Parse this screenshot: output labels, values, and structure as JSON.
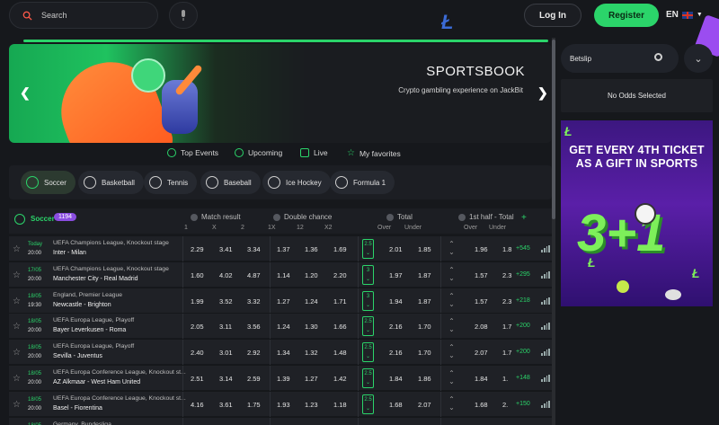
{
  "header": {
    "search_placeholder": "Search",
    "login": "Log In",
    "register": "Register",
    "language": "EN"
  },
  "banner": {
    "title": "SPORTSBOOK",
    "subtitle": "Crypto gambling experience on JackBit"
  },
  "event_tabs": [
    "Top Events",
    "Upcoming",
    "Live",
    "My favorites"
  ],
  "sports": [
    "Soccer",
    "Basketball",
    "Tennis",
    "Baseball",
    "Ice Hockey",
    "Formula 1"
  ],
  "table": {
    "sport": "Soccer",
    "count": "1194",
    "groups": [
      "Match result",
      "Double chance",
      "Total",
      "1st half - Total"
    ],
    "match_result_cols": [
      "1",
      "X",
      "2"
    ],
    "double_chance_cols": [
      "1X",
      "12",
      "X2"
    ],
    "total_cols": [
      "Over",
      "Under"
    ],
    "half_total_cols": [
      "Over",
      "Under"
    ],
    "plus": "+"
  },
  "rows": [
    {
      "d1": "Today",
      "d2": "20:00",
      "league": "UEFA Champions League, Knockout stage",
      "teams": "Inter  -  Milan",
      "o": [
        "2.29",
        "3.41",
        "3.34",
        "1.37",
        "1.36",
        "1.69"
      ],
      "line": "2.5",
      "tot": [
        "2.01",
        "1.85"
      ],
      "half": [
        "1.96",
        "1.8"
      ],
      "more": "+545"
    },
    {
      "d1": "17/05",
      "d2": "20:00",
      "league": "UEFA Champions League, Knockout stage",
      "teams": "Manchester City  -  Real Madrid",
      "o": [
        "1.60",
        "4.02",
        "4.87",
        "1.14",
        "1.20",
        "2.20"
      ],
      "line": "3",
      "tot": [
        "1.97",
        "1.87"
      ],
      "half": [
        "1.57",
        "2.3"
      ],
      "more": "+295"
    },
    {
      "d1": "18/05",
      "d2": "19:30",
      "league": "England, Premier League",
      "teams": "Newcastle  -  Brighton",
      "o": [
        "1.99",
        "3.52",
        "3.32",
        "1.27",
        "1.24",
        "1.71"
      ],
      "line": "3",
      "tot": [
        "1.94",
        "1.87"
      ],
      "half": [
        "1.57",
        "2.3"
      ],
      "more": "+218"
    },
    {
      "d1": "18/05",
      "d2": "20:00",
      "league": "UEFA Europa League, Playoff",
      "teams": "Bayer Leverkusen  -  Roma",
      "o": [
        "2.05",
        "3.11",
        "3.56",
        "1.24",
        "1.30",
        "1.66"
      ],
      "line": "2.5",
      "tot": [
        "2.16",
        "1.70"
      ],
      "half": [
        "2.08",
        "1.7"
      ],
      "more": "+200"
    },
    {
      "d1": "18/05",
      "d2": "20:00",
      "league": "UEFA Europa League, Playoff",
      "teams": "Sevilla  -  Juventus",
      "o": [
        "2.40",
        "3.01",
        "2.92",
        "1.34",
        "1.32",
        "1.48"
      ],
      "line": "2.5",
      "tot": [
        "2.16",
        "1.70"
      ],
      "half": [
        "2.07",
        "1.7"
      ],
      "more": "+200"
    },
    {
      "d1": "18/05",
      "d2": "20:00",
      "league": "UEFA Europa Conference League, Knockout st...",
      "teams": "AZ Alkmaar  -  West Ham United",
      "o": [
        "2.51",
        "3.14",
        "2.59",
        "1.39",
        "1.27",
        "1.42"
      ],
      "line": "2.5",
      "tot": [
        "1.84",
        "1.86"
      ],
      "half": [
        "1.84",
        "1."
      ],
      "more": "+148"
    },
    {
      "d1": "18/05",
      "d2": "20:00",
      "league": "UEFA Europa Conference League, Knockout st...",
      "teams": "Basel  -  Fiorentina",
      "o": [
        "4.16",
        "3.61",
        "1.75",
        "1.93",
        "1.23",
        "1.18"
      ],
      "line": "2.5",
      "tot": [
        "1.68",
        "2.07"
      ],
      "half": [
        "1.68",
        "2."
      ],
      "more": "+150"
    },
    {
      "d1": "18/05",
      "d2": "",
      "league": "Germany, Bundesliga",
      "teams": "",
      "o": [
        "",
        "",
        "",
        "",
        "",
        ""
      ],
      "line": "",
      "tot": [
        "",
        ""
      ],
      "half": [
        "",
        ""
      ],
      "more": ""
    }
  ],
  "betslip": {
    "title": "Betslip",
    "empty": "No Odds Selected"
  },
  "ad": {
    "line1": "GET EVERY 4TH TICKET",
    "line2": "AS A GIFT IN SPORTS",
    "formula": "3+1"
  },
  "colors": {
    "accent": "#2bd46a",
    "bg": "#16181c",
    "purple": "#8a4de0"
  }
}
